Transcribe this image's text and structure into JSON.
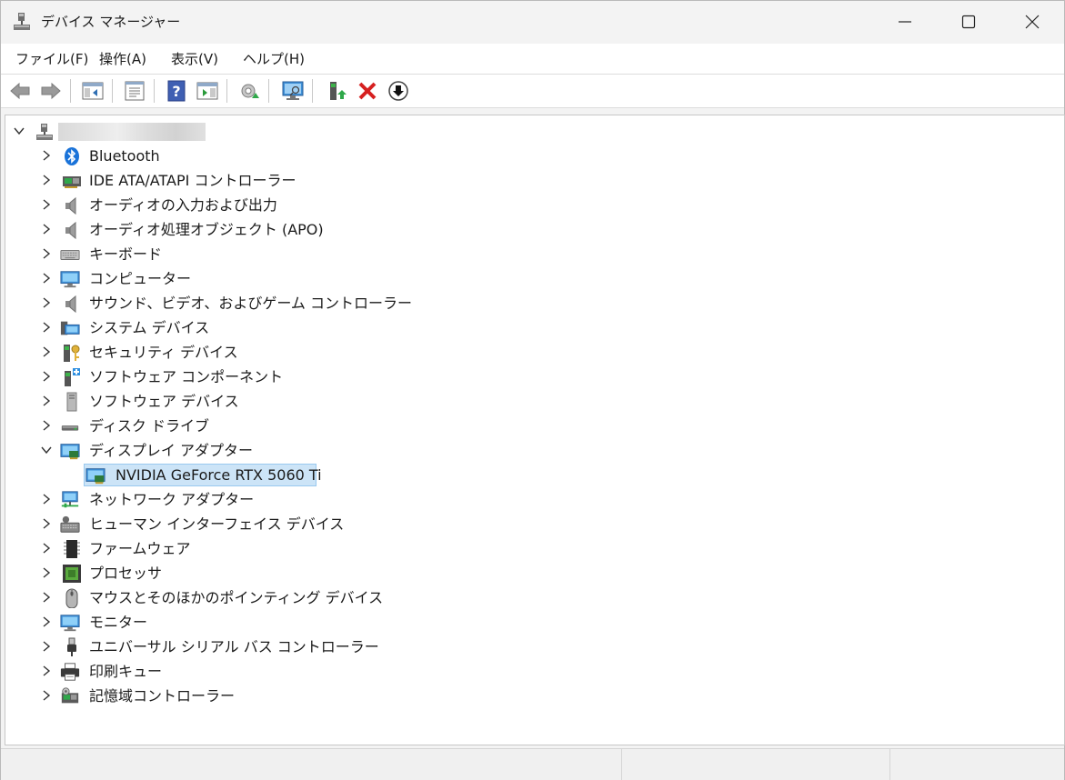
{
  "window": {
    "title": "デバイス マネージャー",
    "controls": [
      "minimize",
      "maximize",
      "close"
    ]
  },
  "menu": [
    {
      "label": "ファイル(F)",
      "icon": null
    },
    {
      "label": "操作(A)",
      "icon": null
    },
    {
      "label": "表示(V)",
      "icon": null
    },
    {
      "label": "ヘルプ(H)",
      "icon": null
    }
  ],
  "toolbar": {
    "buttons": [
      {
        "icon": "back-arrow-icon",
        "enabled": false
      },
      {
        "icon": "forward-arrow-icon",
        "enabled": false
      },
      {
        "icon": "show-hide-console-tree-icon",
        "enabled": true
      },
      {
        "icon": "properties-icon",
        "enabled": true
      },
      {
        "icon": "help-icon",
        "enabled": true
      },
      {
        "icon": "show-action-pane-icon",
        "enabled": true
      },
      {
        "icon": "update-driver-icon",
        "enabled": true
      },
      {
        "icon": "scan-hardware-changes-icon",
        "enabled": true
      },
      {
        "icon": "enable-device-icon",
        "enabled": true
      },
      {
        "icon": "uninstall-device-icon",
        "enabled": true
      },
      {
        "icon": "disable-device-icon",
        "enabled": true
      }
    ]
  },
  "tree": {
    "root": {
      "label": "",
      "icon": "computer-root-icon",
      "expanded": true
    },
    "items": [
      {
        "label": "Bluetooth",
        "icon": "bluetooth-icon",
        "expanded": false
      },
      {
        "label": "IDE ATA/ATAPI コントローラー",
        "icon": "ide-controller-icon",
        "expanded": false
      },
      {
        "label": "オーディオの入力および出力",
        "icon": "speaker-icon",
        "expanded": false
      },
      {
        "label": "オーディオ処理オブジェクト (APO)",
        "icon": "speaker-icon",
        "expanded": false
      },
      {
        "label": "キーボード",
        "icon": "keyboard-icon",
        "expanded": false
      },
      {
        "label": "コンピューター",
        "icon": "computer-icon",
        "expanded": false
      },
      {
        "label": "サウンド、ビデオ、およびゲーム コントローラー",
        "icon": "speaker-icon",
        "expanded": false
      },
      {
        "label": "システム デバイス",
        "icon": "system-device-icon",
        "expanded": false
      },
      {
        "label": "セキュリティ デバイス",
        "icon": "security-key-icon",
        "expanded": false
      },
      {
        "label": "ソフトウェア コンポーネント",
        "icon": "software-component-icon",
        "expanded": false
      },
      {
        "label": "ソフトウェア デバイス",
        "icon": "software-device-icon",
        "expanded": false
      },
      {
        "label": "ディスク ドライブ",
        "icon": "disk-drive-icon",
        "expanded": false
      },
      {
        "label": "ディスプレイ アダプター",
        "icon": "display-adapter-icon",
        "expanded": true,
        "children": [
          {
            "label": "NVIDIA GeForce RTX 5060 Ti",
            "icon": "display-adapter-icon",
            "selected": true
          }
        ]
      },
      {
        "label": "ネットワーク アダプター",
        "icon": "network-adapter-icon",
        "expanded": false
      },
      {
        "label": "ヒューマン インターフェイス デバイス",
        "icon": "hid-icon",
        "expanded": false
      },
      {
        "label": "ファームウェア",
        "icon": "firmware-chip-icon",
        "expanded": false
      },
      {
        "label": "プロセッサ",
        "icon": "processor-icon",
        "expanded": false
      },
      {
        "label": "マウスとそのほかのポインティング デバイス",
        "icon": "mouse-icon",
        "expanded": false
      },
      {
        "label": "モニター",
        "icon": "monitor-icon",
        "expanded": false
      },
      {
        "label": "ユニバーサル シリアル バス コントローラー",
        "icon": "usb-icon",
        "expanded": false
      },
      {
        "label": "印刷キュー",
        "icon": "printer-icon",
        "expanded": false
      },
      {
        "label": "記憶域コントローラー",
        "icon": "storage-controller-icon",
        "expanded": false
      }
    ]
  },
  "statusbar": {
    "panes": [
      "",
      "",
      ""
    ]
  },
  "colors": {
    "selection": "#cce4f7",
    "selection_border": "#99c9ef",
    "close_red": "#d62020"
  }
}
